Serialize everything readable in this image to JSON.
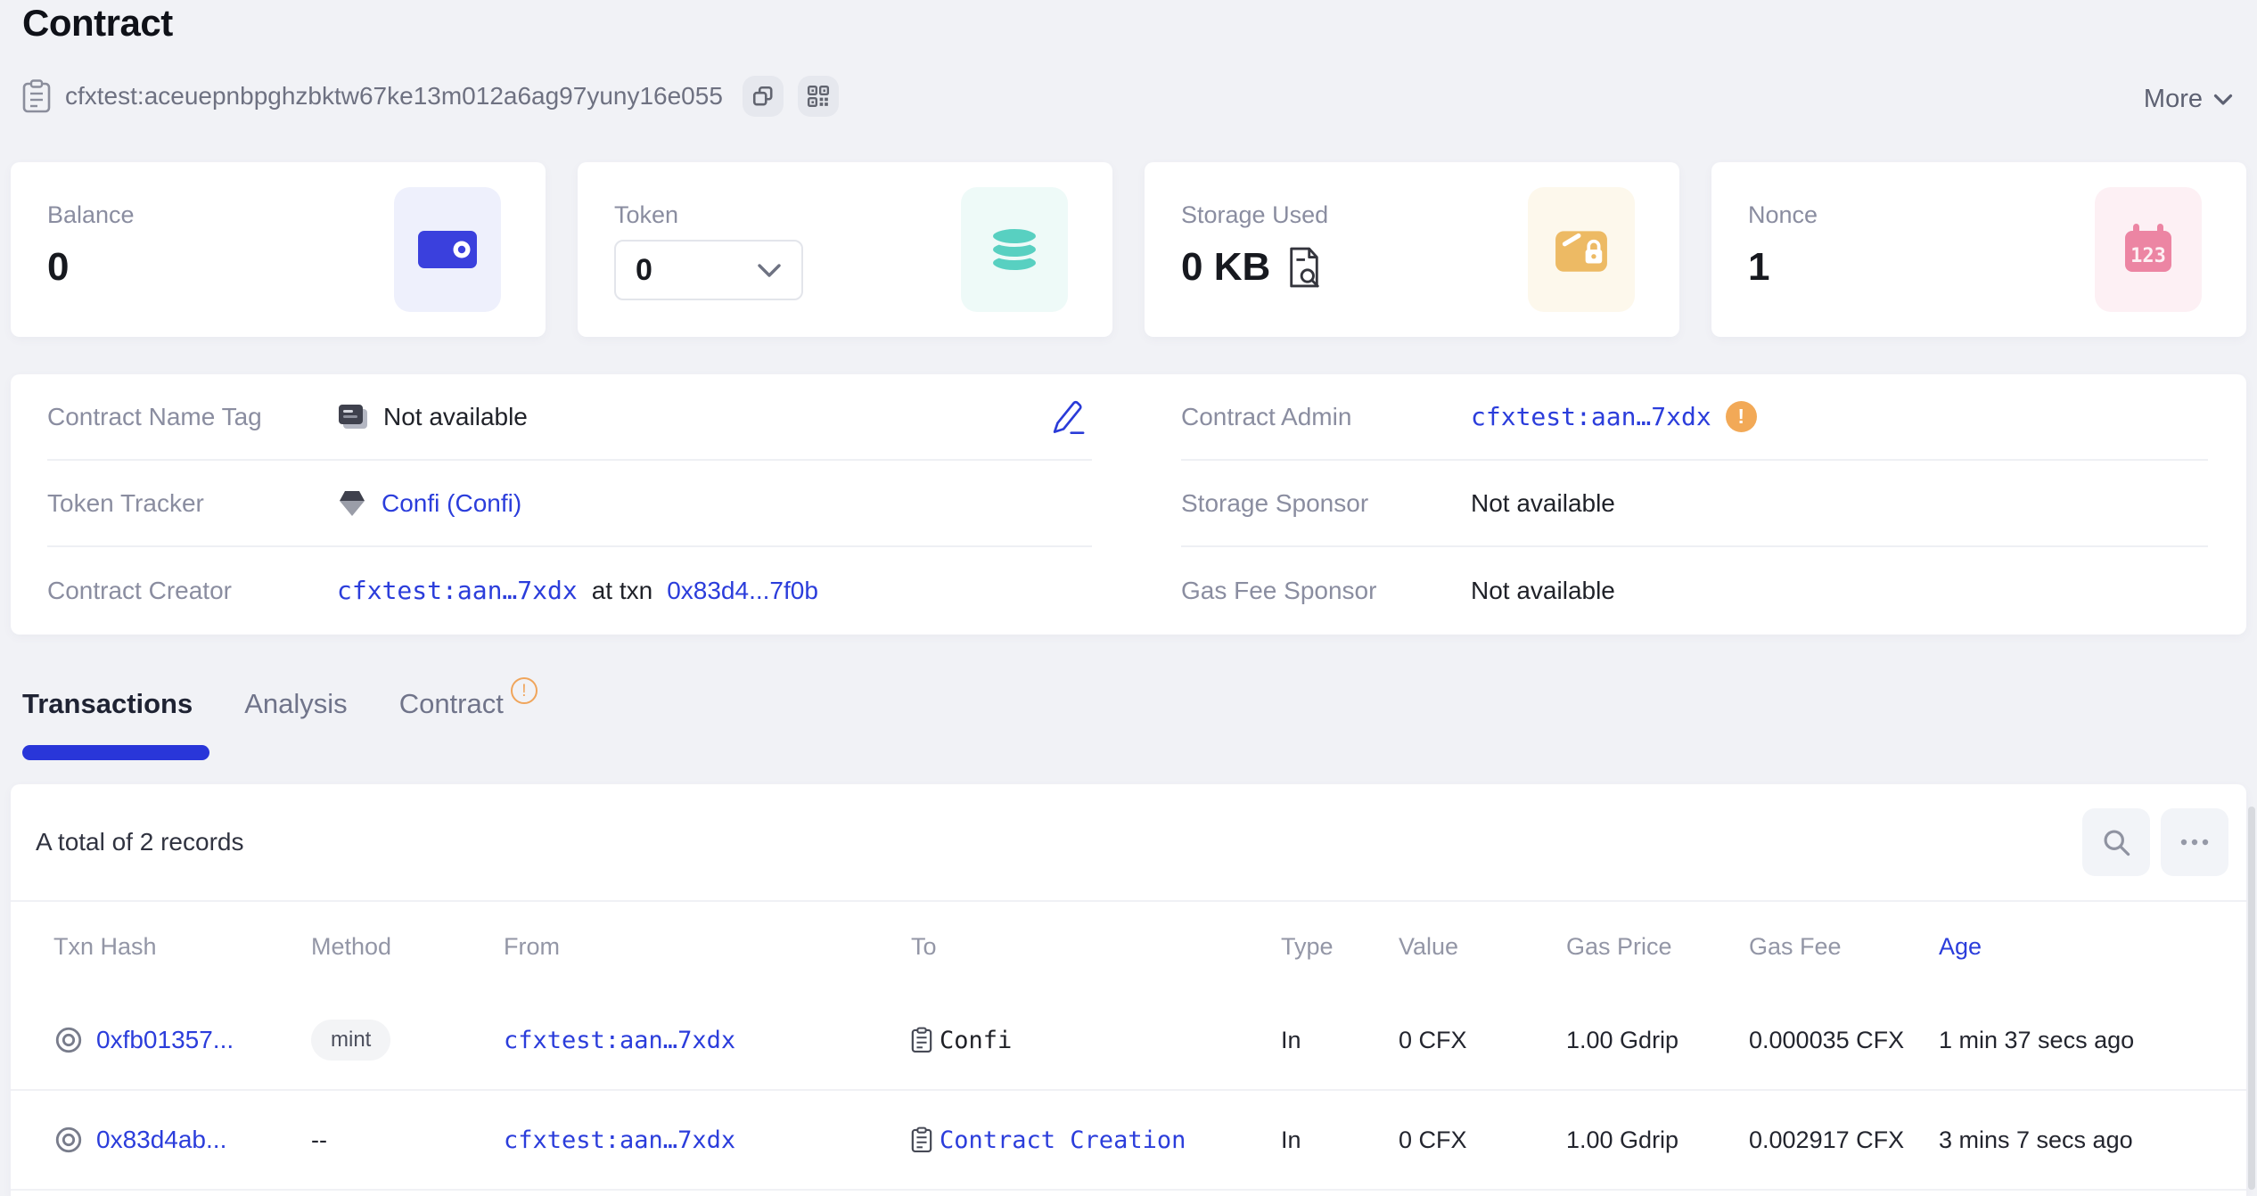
{
  "page": {
    "title": "Contract",
    "more_label": "More"
  },
  "address_bar": {
    "address": "cfxtest:aceuepnbpghzbktw67ke13m012a6ag97yuny16e055",
    "icons": [
      "contract-doc-icon",
      "copy-icon",
      "qr-code-icon"
    ]
  },
  "stats": {
    "balance": {
      "label": "Balance",
      "value": "0",
      "icon": "wallet-icon"
    },
    "token": {
      "label": "Token",
      "selected": "0",
      "icon": "token-stack-icon"
    },
    "storage": {
      "label": "Storage Used",
      "value": "0 KB",
      "icon": "storage-box-icon",
      "inline_icon": "storage-detail-icon"
    },
    "nonce": {
      "label": "Nonce",
      "value": "1",
      "icon": "nonce-calendar-icon"
    }
  },
  "info": {
    "name_tag": {
      "label": "Contract Name Tag",
      "value": "Not available"
    },
    "token_tracker": {
      "label": "Token Tracker",
      "value": "Confi (Confi)"
    },
    "creator": {
      "label": "Contract Creator",
      "address": "cfxtest:aan…7xdx",
      "middle": "at txn",
      "txn": "0x83d4...7f0b"
    },
    "admin": {
      "label": "Contract Admin",
      "value": "cfxtest:aan…7xdx",
      "badge": "!"
    },
    "storage_sponsor": {
      "label": "Storage Sponsor",
      "value": "Not available"
    },
    "gas_sponsor": {
      "label": "Gas Fee Sponsor",
      "value": "Not available"
    }
  },
  "tabs": {
    "transactions": "Transactions",
    "analysis": "Analysis",
    "contract": "Contract",
    "contract_badge": "!"
  },
  "table": {
    "summary": "A total of 2 records",
    "columns": [
      "Txn Hash",
      "Method",
      "From",
      "To",
      "Type",
      "Value",
      "Gas Price",
      "Gas Fee",
      "Age"
    ],
    "rows": [
      {
        "hash": "0xfb01357...",
        "method": "mint",
        "from": "cfxtest:aan…7xdx",
        "to": "Confi",
        "type": "In",
        "value": "0 CFX",
        "gas_price": "1.00 Gdrip",
        "gas_fee": "0.000035 CFX",
        "age": "1 min 37 secs ago"
      },
      {
        "hash": "0x83d4ab...",
        "method": "--",
        "from": "cfxtest:aan…7xdx",
        "to": "Contract Creation",
        "type": "In",
        "value": "0 CFX",
        "gas_price": "1.00 Gdrip",
        "gas_fee": "0.002917 CFX",
        "age": "3 mins 7 secs ago"
      }
    ]
  },
  "colors": {
    "link_blue": "#2b3ddb",
    "accent_blue": "#2936d9",
    "warning_orange": "#f2a957",
    "teal": "#58d0c1",
    "amber": "#edba64",
    "pink": "#ec85a3",
    "background": "#f1f2f6"
  }
}
